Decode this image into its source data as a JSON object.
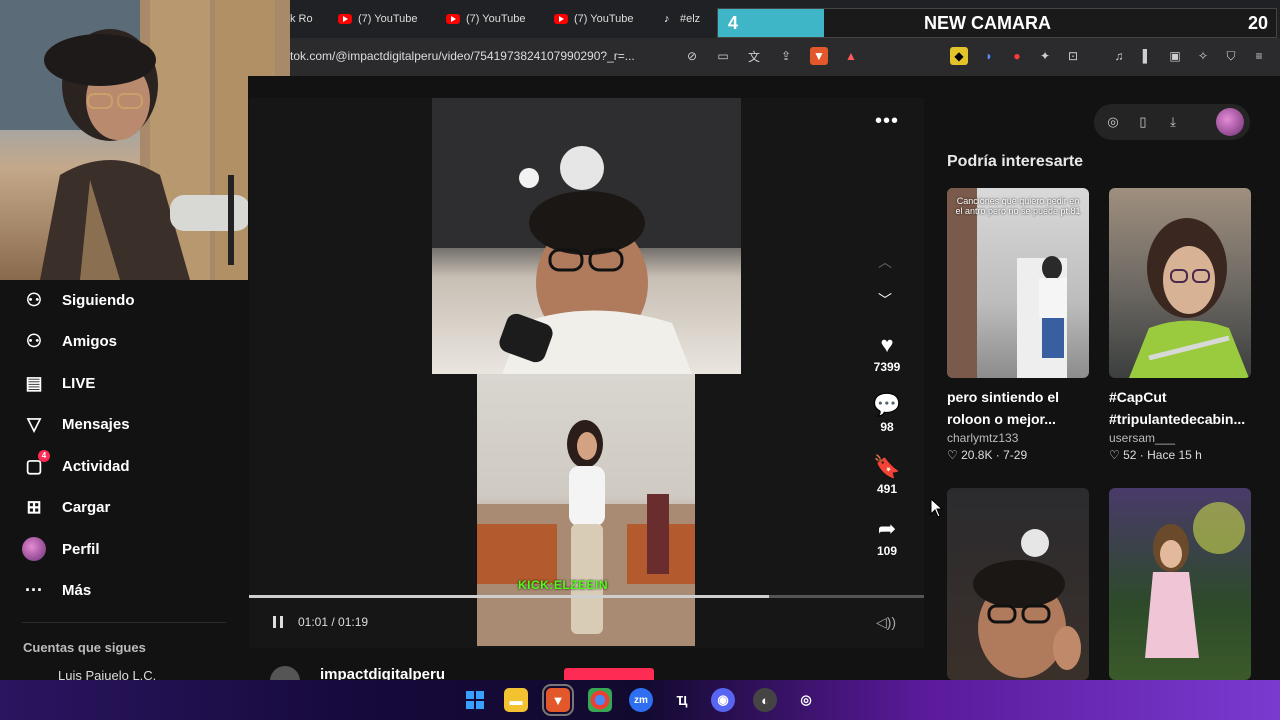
{
  "overlay": {
    "number": "4",
    "title": "NEW CAMARA",
    "count": "20"
  },
  "tabs": [
    {
      "label": "k Ro",
      "icon": "none"
    },
    {
      "label": "(7) YouTube",
      "icon": "youtube-icon"
    },
    {
      "label": "(7) YouTube",
      "icon": "youtube-icon"
    },
    {
      "label": "(7) YouTube",
      "icon": "youtube-icon"
    },
    {
      "label": "#elz",
      "icon": "tiktok-icon"
    }
  ],
  "address": {
    "url": "tok.com/@impactdigitalperu/video/7541973824107990290?_r=..."
  },
  "sidebar": {
    "items": [
      {
        "label": "Siguiendo",
        "icon": "following-icon"
      },
      {
        "label": "Amigos",
        "icon": "friends-icon"
      },
      {
        "label": "LIVE",
        "icon": "live-icon"
      },
      {
        "label": "Mensajes",
        "icon": "messages-icon"
      },
      {
        "label": "Actividad",
        "icon": "activity-icon",
        "badge": "4"
      },
      {
        "label": "Cargar",
        "icon": "upload-icon"
      },
      {
        "label": "Perfil",
        "icon": "profile-avatar"
      },
      {
        "label": "Más",
        "icon": "more-icon"
      }
    ],
    "follows_title": "Cuentas que sigues",
    "follows_first": "Luis Paiuelo L.C."
  },
  "video": {
    "overlay_text": "KICK:ELZEEIN",
    "time": "01:01 / 01:19",
    "progress": 0.77,
    "author": "impactdigitalperu",
    "likes": "7399",
    "comments": "98",
    "saves": "491",
    "shares": "109"
  },
  "recommend": {
    "title": "Podría interesarte",
    "cards": [
      {
        "caption": "pero sintiendo el roloon o mejor...",
        "user": "charlymtz133",
        "likes": "20.8K",
        "date": "7-29",
        "thumb_text": "Canciones que quiero pedir en el antro pero no se puede pt.81"
      },
      {
        "caption": "#CapCut #tripulantedecabin...",
        "user": "usersam___",
        "likes": "52",
        "date": "Hace 15 h",
        "thumb_text": ""
      },
      {
        "caption": "",
        "user": "",
        "likes": "",
        "date": "",
        "thumb_text": ""
      },
      {
        "caption": "",
        "user": "",
        "likes": "",
        "date": "",
        "thumb_text": ""
      }
    ]
  },
  "colors": {
    "accent": "#fe2c55",
    "kick": "#53fc18",
    "overlay_cyan": "#3fb5c8"
  }
}
